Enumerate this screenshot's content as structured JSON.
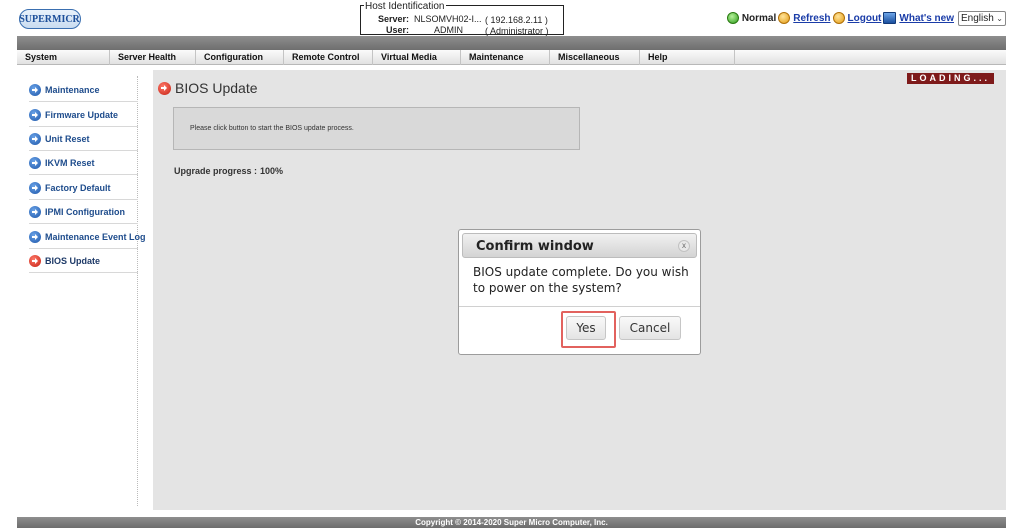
{
  "header": {
    "logo_text": "SUPERMICR",
    "host": {
      "legend": "Host Identification",
      "server_label": "Server:",
      "server_value": "NLSOMVH02-I...",
      "ip": "( 192.168.2.11 )",
      "user_label": "User:",
      "user_value": "ADMIN",
      "role": "( Administrator )"
    },
    "links": {
      "normal": "Normal",
      "refresh": "Refresh",
      "logout": "Logout",
      "whats_new": "What's new"
    },
    "language": "English"
  },
  "nav": [
    "System",
    "Server Health",
    "Configuration",
    "Remote Control",
    "Virtual Media",
    "Maintenance",
    "Miscellaneous",
    "Help"
  ],
  "sidebar": {
    "items": [
      {
        "label": "Maintenance"
      },
      {
        "label": "Firmware Update"
      },
      {
        "label": "Unit Reset"
      },
      {
        "label": "IKVM Reset"
      },
      {
        "label": "Factory Default"
      },
      {
        "label": "IPMI Configuration"
      },
      {
        "label": "Maintenance Event Log"
      },
      {
        "label": "BIOS Update"
      }
    ],
    "active_index": 7
  },
  "main": {
    "title": "BIOS Update",
    "loading": "LOADING...",
    "message": "Please click button to start the BIOS update process.",
    "progress_label": "Upgrade progress :",
    "progress_value": "100%"
  },
  "modal": {
    "title": "Confirm window",
    "close": "x",
    "body": "BIOS update complete. Do you wish to power on the system?",
    "yes": "Yes",
    "cancel": "Cancel"
  },
  "footer": {
    "copyright": "Copyright © 2014-2020 Super Micro Computer, Inc."
  },
  "colors": {
    "accent_link": "#1a3ca8",
    "loading_bg": "#7e1a1a",
    "highlight_ring": "#e2625e"
  }
}
